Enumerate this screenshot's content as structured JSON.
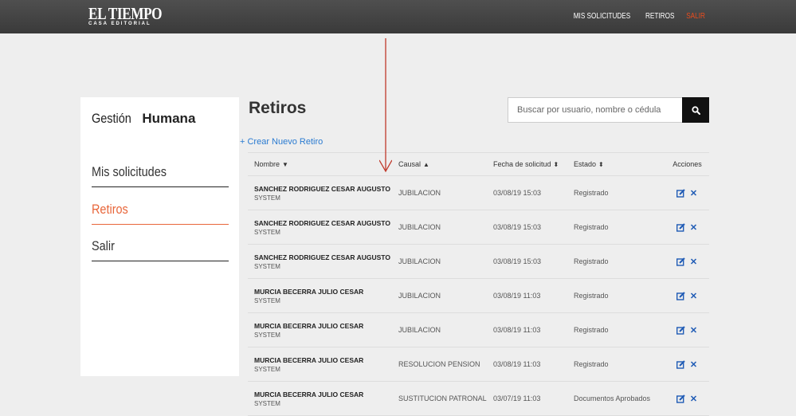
{
  "brand": {
    "name": "EL TIEMPO",
    "tagline": "CASA EDITORIAL"
  },
  "topnav": [
    {
      "label": "MIS SOLICITUDES"
    },
    {
      "label": "RETIROS"
    },
    {
      "label": "SALIR"
    }
  ],
  "sidebar": {
    "title_light": "Gestión",
    "title_bold": "Humana",
    "items": [
      {
        "label": "Mis solicitudes"
      },
      {
        "label": "Retiros"
      },
      {
        "label": "Salir"
      }
    ]
  },
  "main": {
    "title": "Retiros",
    "search_placeholder": "Buscar por usuario, nombre o cédula",
    "create_link": "+ Crear Nuevo Retiro",
    "columns": {
      "nombre": "Nombre",
      "causal": "Causal",
      "fecha": "Fecha de solicitud",
      "estado": "Estado",
      "acciones": "Acciones"
    },
    "rows": [
      {
        "name": "SANCHEZ RODRIGUEZ CESAR AUGUSTO",
        "user": "SYSTEM",
        "causal": "JUBILACION",
        "fecha": "03/08/19 15:03",
        "estado": "Registrado"
      },
      {
        "name": "SANCHEZ RODRIGUEZ CESAR AUGUSTO",
        "user": "SYSTEM",
        "causal": "JUBILACION",
        "fecha": "03/08/19 15:03",
        "estado": "Registrado"
      },
      {
        "name": "SANCHEZ RODRIGUEZ CESAR AUGUSTO",
        "user": "SYSTEM",
        "causal": "JUBILACION",
        "fecha": "03/08/19 15:03",
        "estado": "Registrado"
      },
      {
        "name": "MURCIA BECERRA JULIO CESAR",
        "user": "SYSTEM",
        "causal": "JUBILACION",
        "fecha": "03/08/19 11:03",
        "estado": "Registrado"
      },
      {
        "name": "MURCIA BECERRA JULIO CESAR",
        "user": "SYSTEM",
        "causal": "JUBILACION",
        "fecha": "03/08/19 11:03",
        "estado": "Registrado"
      },
      {
        "name": "MURCIA BECERRA JULIO CESAR",
        "user": "SYSTEM",
        "causal": "RESOLUCION PENSION",
        "fecha": "03/08/19 11:03",
        "estado": "Registrado"
      },
      {
        "name": "MURCIA BECERRA JULIO CESAR",
        "user": "SYSTEM",
        "causal": "SUSTITUCION PATRONAL",
        "fecha": "03/07/19 11:03",
        "estado": "Documentos Aprobados"
      }
    ]
  },
  "colors": {
    "topbar": "#444444",
    "accent": "#e8663a",
    "link": "#2a7bd1",
    "status_registered": "#4caf50",
    "annotation_arrow": "#c0392b"
  },
  "icons": {
    "search": "search-icon",
    "edit": "edit-icon",
    "delete": "close-icon",
    "sort_down": "caret-down-icon",
    "sort_up": "caret-up-icon",
    "sort_both": "sort-icon"
  }
}
